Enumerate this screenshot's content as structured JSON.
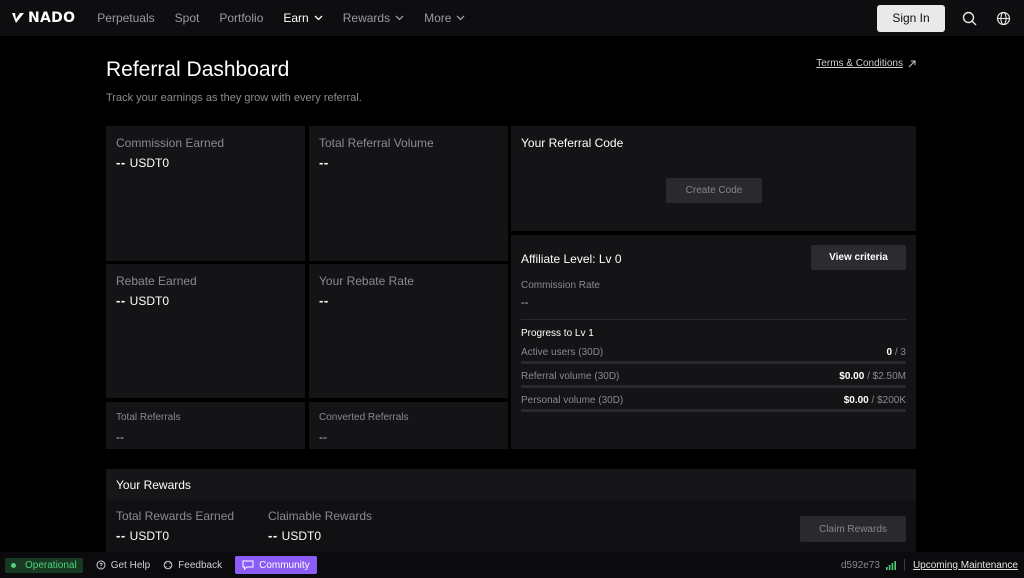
{
  "nav": {
    "logo": "NADO",
    "items": [
      {
        "label": "Perpetuals",
        "dropdown": false,
        "active": false
      },
      {
        "label": "Spot",
        "dropdown": false,
        "active": false
      },
      {
        "label": "Portfolio",
        "dropdown": false,
        "active": false
      },
      {
        "label": "Earn",
        "dropdown": true,
        "active": true
      },
      {
        "label": "Rewards",
        "dropdown": true,
        "active": false
      },
      {
        "label": "More",
        "dropdown": true,
        "active": false
      }
    ],
    "sign_in": "Sign In",
    "icons": [
      "search-icon",
      "globe-icon"
    ]
  },
  "header": {
    "title": "Referral Dashboard",
    "subtitle": "Track your earnings as they grow with every referral.",
    "terms": "Terms & Conditions"
  },
  "stats": {
    "commission_earned": {
      "label": "Commission Earned",
      "value": "--",
      "unit": "USDT0"
    },
    "total_referral_volume": {
      "label": "Total Referral Volume",
      "value": "--"
    },
    "rebate_earned": {
      "label": "Rebate Earned",
      "value": "--",
      "unit": "USDT0"
    },
    "your_rebate_rate": {
      "label": "Your Rebate Rate",
      "value": "--"
    },
    "total_referrals": {
      "label": "Total Referrals",
      "value": "--"
    },
    "converted_referrals": {
      "label": "Converted Referrals",
      "value": "--"
    }
  },
  "referral_code": {
    "title": "Your Referral Code",
    "create_button": "Create Code"
  },
  "affiliate": {
    "title": "Affiliate Level: Lv 0",
    "view_criteria": "View criteria",
    "commission_rate_label": "Commission Rate",
    "commission_rate_value": "--",
    "progress_title": "Progress to Lv 1",
    "rows": [
      {
        "label": "Active users (30D)",
        "current": "0",
        "target": " / 3",
        "progress": 0
      },
      {
        "label": "Referral volume (30D)",
        "current": "$0.00",
        "target": " / $2.50M",
        "progress": 0
      },
      {
        "label": "Personal volume (30D)",
        "current": "$0.00",
        "target": " / $200K",
        "progress": 0
      }
    ]
  },
  "rewards": {
    "title": "Your Rewards",
    "total_label": "Total Rewards Earned",
    "total_value": "--",
    "total_unit": "USDT0",
    "claimable_label": "Claimable Rewards",
    "claimable_value": "--",
    "claimable_unit": "USDT0",
    "claim_button": "Claim Rewards"
  },
  "footer": {
    "status": "Operational",
    "get_help": "Get Help",
    "feedback": "Feedback",
    "community": "Community",
    "version": "d592e73",
    "maintenance": "Upcoming Maintenance"
  },
  "colors": {
    "background": "#000000",
    "card": "#141416",
    "accent_status": "#4ed07a",
    "community": "#8b5cf6"
  }
}
